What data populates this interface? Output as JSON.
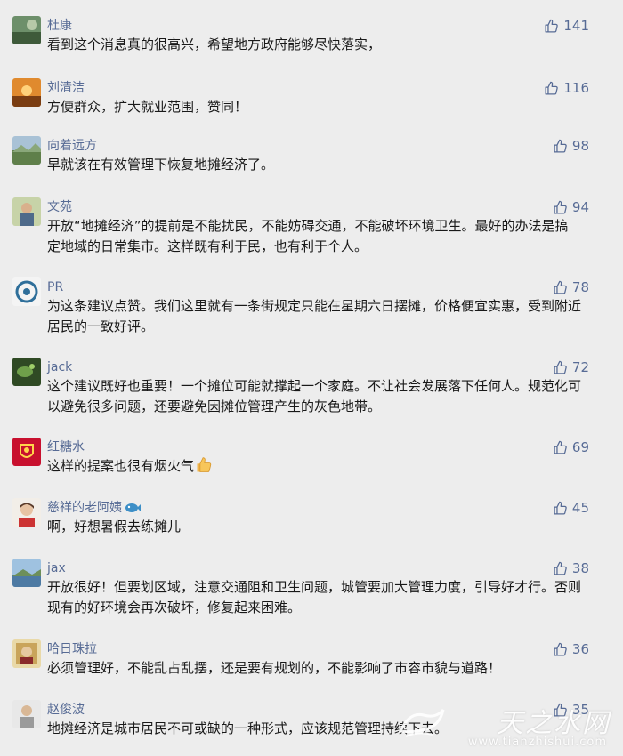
{
  "comments": [
    {
      "name": "杜康",
      "text": "看到这个消息真的很高兴，希望地方政府能够尽快落实，",
      "likes": "141"
    },
    {
      "name": "刘清洁",
      "text": "方便群众，扩大就业范围，赞同！",
      "likes": "116"
    },
    {
      "name": "向着远方",
      "text": "早就该在有效管理下恢复地摊经济了。",
      "likes": "98"
    },
    {
      "name": "文苑",
      "text": "开放“地摊经济”的提前是不能扰民，不能妨碍交通，不能破坏环境卫生。最好的办法是搞定地域的日常集市。这样既有利于民，也有利于个人。",
      "likes": "94"
    },
    {
      "name": "PR",
      "text": "为这条建议点赞。我们这里就有一条街规定只能在星期六日摆摊，价格便宜实惠，受到附近居民的一致好评。",
      "likes": "78"
    },
    {
      "name": "jack",
      "text": "这个建议既好也重要！一个摊位可能就撑起一个家庭。不让社会发展落下任何人。规范化可以避免很多问题，还要避免因摊位管理产生的灰色地带。",
      "likes": "72"
    },
    {
      "name": "红糖水",
      "text": "这样的提案也很有烟火气",
      "likes": "69"
    },
    {
      "name": "慈祥的老阿姨",
      "text": "啊，好想暑假去练摊儿",
      "likes": "45"
    },
    {
      "name": "jax",
      "text": "开放很好！但要划区域，注意交通阻和卫生问题，城管要加大管理力度，引导好才行。否则现有的好环境会再次破坏，修复起来困难。",
      "likes": "38"
    },
    {
      "name": "哈日珠拉",
      "text": "必须管理好，不能乱占乱摆，还是要有规划的，不能影响了市容市貌与道路！",
      "likes": "36"
    },
    {
      "name": "赵俊波",
      "text": "地摊经济是城市居民不可或缺的一种形式，应该规范管理持续下去。",
      "likes": "35"
    }
  ],
  "watermark": {
    "site": "天之水网",
    "url": "www.tianzhishui.com"
  },
  "colors": {
    "name": "#576b95",
    "text": "#191919",
    "background": "#ededed"
  }
}
